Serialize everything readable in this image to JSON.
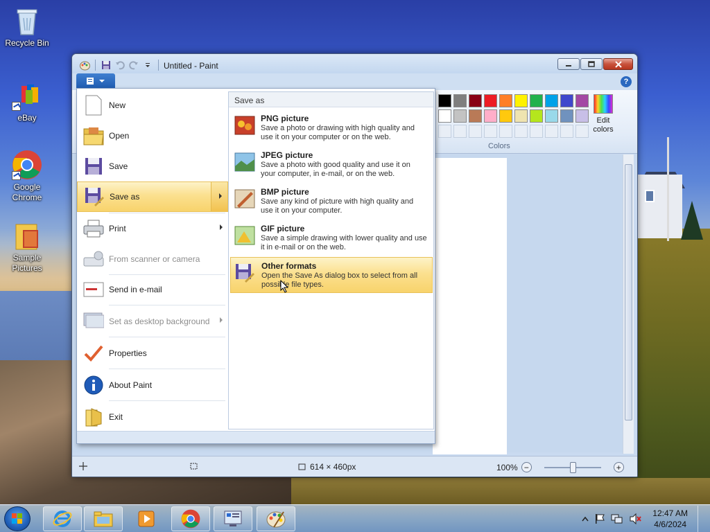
{
  "desktop": {
    "icons": [
      {
        "label": "Recycle Bin"
      },
      {
        "label": "eBay"
      },
      {
        "label": "Google Chrome"
      },
      {
        "label": "Sample Pictures"
      }
    ]
  },
  "window": {
    "title": "Untitled - Paint"
  },
  "ribbon": {
    "colors_label": "Colors",
    "edit_colors_label": "Edit colors",
    "palette_row1": [
      "#000000",
      "#7f7f7f",
      "#880015",
      "#ed1c24",
      "#ff7f27",
      "#fff200",
      "#22b14c",
      "#00a2e8",
      "#3f48cc",
      "#a349a4"
    ],
    "palette_row2": [
      "#ffffff",
      "#c3c3c3",
      "#b97a57",
      "#ffaec9",
      "#ffc90e",
      "#efe4b0",
      "#b5e61d",
      "#99d9ea",
      "#7092be",
      "#c8bfe7"
    ]
  },
  "file_menu": {
    "items": [
      {
        "label": "New",
        "icon": "new-document-icon"
      },
      {
        "label": "Open",
        "icon": "open-folder-icon"
      },
      {
        "label": "Save",
        "icon": "save-disk-icon"
      },
      {
        "label": "Save as",
        "icon": "save-as-icon"
      },
      {
        "label": "Print",
        "icon": "printer-icon"
      },
      {
        "label": "From scanner or camera",
        "icon": "scanner-icon"
      },
      {
        "label": "Send in e-mail",
        "icon": "email-icon"
      },
      {
        "label": "Set as desktop background",
        "icon": "desktop-background-icon"
      },
      {
        "label": "Properties",
        "icon": "checkmark-icon"
      },
      {
        "label": "About Paint",
        "icon": "info-icon"
      },
      {
        "label": "Exit",
        "icon": "exit-icon"
      }
    ],
    "submenu": {
      "header": "Save as",
      "items": [
        {
          "title": "PNG picture",
          "desc": "Save a photo or drawing with high quality and use it on your computer or on the web."
        },
        {
          "title": "JPEG picture",
          "desc": "Save a photo with good quality and use it on your computer, in e-mail, or on the web."
        },
        {
          "title": "BMP picture",
          "desc": "Save any kind of picture with high quality and use it on your computer."
        },
        {
          "title": "GIF picture",
          "desc": "Save a simple drawing with lower quality and use it in e-mail or on the web."
        },
        {
          "title": "Other formats",
          "desc": "Open the Save As dialog box to select from all possible file types."
        }
      ]
    }
  },
  "statusbar": {
    "dimensions": "614 × 460px",
    "zoom": "100%"
  },
  "taskbar": {
    "time": "12:47 AM",
    "date": "4/6/2024"
  }
}
